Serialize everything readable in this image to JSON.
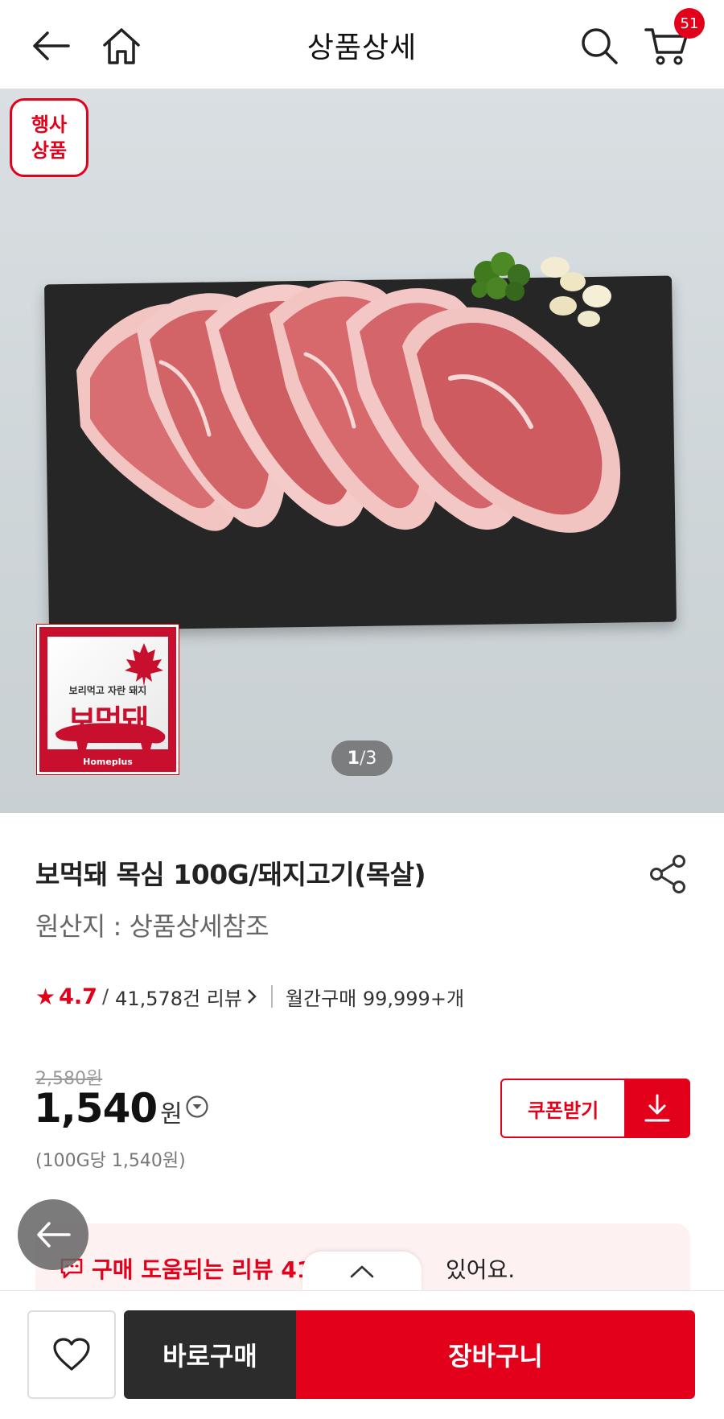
{
  "header": {
    "title": "상품상세",
    "cart_count": "51",
    "icons": {
      "back": "back-arrow-icon",
      "home": "home-icon",
      "search": "search-icon",
      "cart": "cart-icon"
    }
  },
  "hero": {
    "event_badge": "행사\n상품",
    "brand_logo": {
      "small_text": "보리먹고 자란 돼지",
      "big_text": "보먹돼",
      "footer": "Homeplus"
    },
    "pager": {
      "current": "1",
      "separator": "/",
      "total": "3"
    }
  },
  "product": {
    "name": "보먹돼 목심 100G/돼지고기(목살)",
    "origin": "원산지 : 상품상세참조",
    "rating": "4.7",
    "review_count": "41,578건 리뷰",
    "monthly_sales": "월간구매 99,999+개",
    "original_price": "2,580원",
    "price": "1,540",
    "currency": "원",
    "unit_price": "(100G당 1,540원)",
    "coupon_label": "쿠폰받기"
  },
  "review_banner": {
    "text": "구매 도움되는 리뷰 41",
    "tail": "있어요."
  },
  "bottom_bar": {
    "buy_now": "바로구매",
    "add_to_cart": "장바구니"
  },
  "colors": {
    "accent": "#e3001b",
    "dark": "#2c2c2c"
  }
}
